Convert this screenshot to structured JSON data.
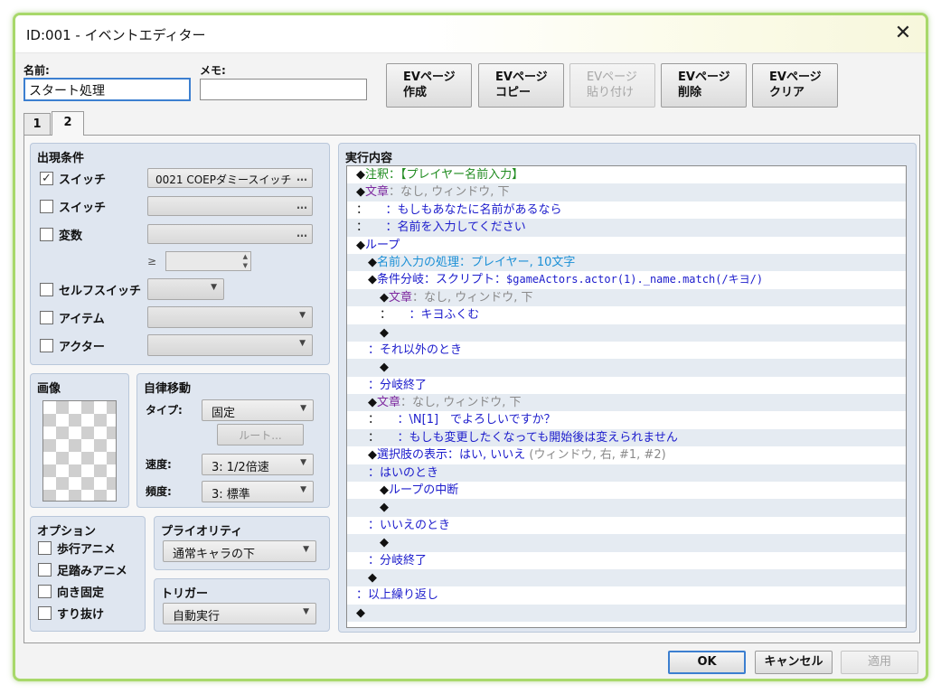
{
  "window": {
    "title": "ID:001 - イベントエディター",
    "close_glyph": "✕"
  },
  "header": {
    "name_label": "名前:",
    "name_value": "スタート処理",
    "memo_label": "メモ:",
    "memo_value": ""
  },
  "ev_buttons": [
    {
      "line1": "EVページ",
      "line2": "作成",
      "enabled": true
    },
    {
      "line1": "EVページ",
      "line2": "コピー",
      "enabled": true
    },
    {
      "line1": "EVページ",
      "line2": "貼り付け",
      "enabled": false
    },
    {
      "line1": "EVページ",
      "line2": "削除",
      "enabled": true
    },
    {
      "line1": "EVページ",
      "line2": "クリア",
      "enabled": true
    }
  ],
  "tabs": [
    {
      "label": "1"
    },
    {
      "label": "2"
    }
  ],
  "conditions": {
    "title": "出現条件",
    "switch1": {
      "label": "スイッチ",
      "checked": true,
      "mark": "✓",
      "value": "0021 COEPダミースイッチ",
      "dots": "…"
    },
    "switch2": {
      "label": "スイッチ",
      "checked": false,
      "dots": "…"
    },
    "variable": {
      "label": "変数",
      "checked": false,
      "dots": "…",
      "ge": "≥"
    },
    "self_switch": {
      "label": "セルフスイッチ",
      "checked": false
    },
    "item": {
      "label": "アイテム",
      "checked": false
    },
    "actor": {
      "label": "アクター",
      "checked": false
    }
  },
  "image": {
    "title": "画像"
  },
  "autonomous": {
    "title": "自律移動",
    "type_label": "タイプ:",
    "type_value": "固定",
    "route_label": "ルート...",
    "speed_label": "速度:",
    "speed_value": "3: 1/2倍速",
    "freq_label": "頻度:",
    "freq_value": "3: 標準"
  },
  "options": {
    "title": "オプション",
    "items": [
      {
        "label": "歩行アニメ",
        "checked": false
      },
      {
        "label": "足踏みアニメ",
        "checked": false
      },
      {
        "label": "向き固定",
        "checked": false
      },
      {
        "label": "すり抜け",
        "checked": false
      }
    ]
  },
  "priority": {
    "title": "プライオリティ",
    "value": "通常キャラの下"
  },
  "trigger": {
    "title": "トリガー",
    "value": "自動実行"
  },
  "contents": {
    "title": "実行内容",
    "lines": [
      {
        "indent": 0,
        "parts": [
          {
            "t": "◆",
            "c": "blk"
          },
          {
            "t": "注釈：【プレイヤー名前入力】",
            "c": "green"
          }
        ]
      },
      {
        "indent": 0,
        "parts": [
          {
            "t": "◆",
            "c": "blk"
          },
          {
            "t": "文章",
            "c": "purple"
          },
          {
            "t": "：なし, ウィンドウ, 下",
            "c": "gray"
          }
        ]
      },
      {
        "indent": 0,
        "parts": [
          {
            "t": "：",
            "c": "blk"
          },
          {
            "t": "　　：もしもあなたに名前があるなら",
            "c": "navy"
          }
        ]
      },
      {
        "indent": 0,
        "parts": [
          {
            "t": "：",
            "c": "blk"
          },
          {
            "t": "　　：名前を入力してください",
            "c": "navy"
          }
        ]
      },
      {
        "indent": 0,
        "parts": [
          {
            "t": "◆",
            "c": "blk"
          },
          {
            "t": "ループ",
            "c": "navy"
          }
        ]
      },
      {
        "indent": 1,
        "parts": [
          {
            "t": "◆",
            "c": "blk"
          },
          {
            "t": "名前入力の処理：プレイヤー, 10文字",
            "c": "sky"
          }
        ]
      },
      {
        "indent": 1,
        "parts": [
          {
            "t": "◆",
            "c": "blk"
          },
          {
            "t": "条件分岐：スクリプト：",
            "c": "navy"
          },
          {
            "t": "$gameActors.actor(1)._name.match(/キヨ/)",
            "c": "navy",
            "mono": true
          }
        ]
      },
      {
        "indent": 2,
        "parts": [
          {
            "t": "◆",
            "c": "blk"
          },
          {
            "t": "文章",
            "c": "purple"
          },
          {
            "t": "：なし, ウィンドウ, 下",
            "c": "gray"
          }
        ]
      },
      {
        "indent": 2,
        "parts": [
          {
            "t": "：",
            "c": "blk"
          },
          {
            "t": "　　：キヨふくむ",
            "c": "navy"
          }
        ]
      },
      {
        "indent": 2,
        "parts": [
          {
            "t": "◆",
            "c": "blk"
          }
        ]
      },
      {
        "indent": 1,
        "parts": [
          {
            "t": "：それ以外のとき",
            "c": "navy"
          }
        ]
      },
      {
        "indent": 2,
        "parts": [
          {
            "t": "◆",
            "c": "blk"
          }
        ]
      },
      {
        "indent": 1,
        "parts": [
          {
            "t": "：分岐終了",
            "c": "navy"
          }
        ]
      },
      {
        "indent": 1,
        "parts": [
          {
            "t": "◆",
            "c": "blk"
          },
          {
            "t": "文章",
            "c": "purple"
          },
          {
            "t": "：なし, ウィンドウ, 下",
            "c": "gray"
          }
        ]
      },
      {
        "indent": 1,
        "parts": [
          {
            "t": "：",
            "c": "blk"
          },
          {
            "t": "　　：\\N[1]　でよろしいですか？",
            "c": "navy"
          }
        ]
      },
      {
        "indent": 1,
        "parts": [
          {
            "t": "：",
            "c": "blk"
          },
          {
            "t": "　　：もしも変更したくなっても開始後は変えられません",
            "c": "navy"
          }
        ]
      },
      {
        "indent": 1,
        "parts": [
          {
            "t": "◆",
            "c": "blk"
          },
          {
            "t": "選択肢の表示：はい, いいえ",
            "c": "navy"
          },
          {
            "t": " (ウィンドウ, 右, #1, #2)",
            "c": "gray"
          }
        ]
      },
      {
        "indent": 1,
        "parts": [
          {
            "t": "：はいのとき",
            "c": "navy"
          }
        ]
      },
      {
        "indent": 2,
        "parts": [
          {
            "t": "◆",
            "c": "blk"
          },
          {
            "t": "ループの中断",
            "c": "navy"
          }
        ]
      },
      {
        "indent": 2,
        "parts": [
          {
            "t": "◆",
            "c": "blk"
          }
        ]
      },
      {
        "indent": 1,
        "parts": [
          {
            "t": "：いいえのとき",
            "c": "navy"
          }
        ]
      },
      {
        "indent": 2,
        "parts": [
          {
            "t": "◆",
            "c": "blk"
          }
        ]
      },
      {
        "indent": 1,
        "parts": [
          {
            "t": "：分岐終了",
            "c": "navy"
          }
        ]
      },
      {
        "indent": 1,
        "parts": [
          {
            "t": "◆",
            "c": "blk"
          }
        ]
      },
      {
        "indent": 0,
        "parts": [
          {
            "t": "：以上繰り返し",
            "c": "navy"
          }
        ]
      },
      {
        "indent": 0,
        "parts": [
          {
            "t": "◆",
            "c": "blk"
          }
        ]
      }
    ]
  },
  "footer": {
    "ok": "OK",
    "cancel": "キャンセル",
    "apply": "適用"
  }
}
